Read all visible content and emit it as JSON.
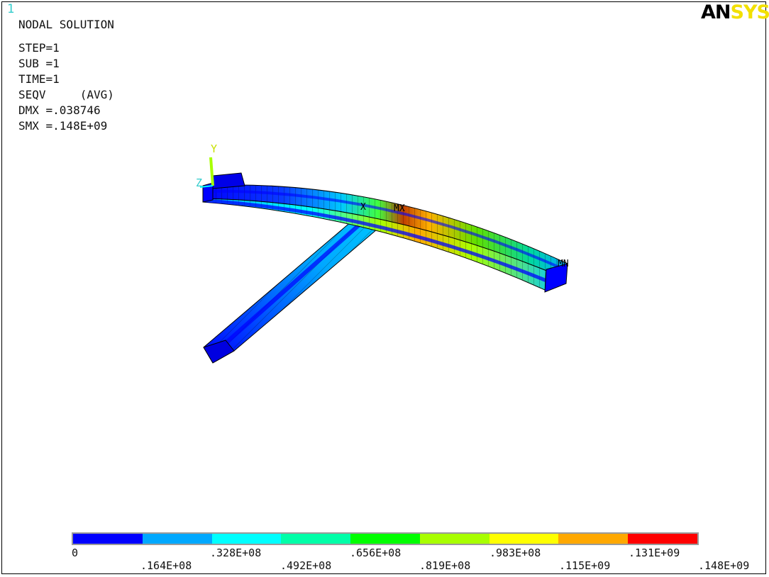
{
  "window_number": "1",
  "logo": {
    "an": "AN",
    "sys": "SYS"
  },
  "info": {
    "title": "NODAL SOLUTION",
    "step": "STEP=1",
    "sub": "SUB =1",
    "time": "TIME=1",
    "seqv": "SEQV     (AVG)",
    "dmx": "DMX =.038746",
    "smx": "SMX =.148E+09"
  },
  "axis_labels": {
    "y": "Y",
    "z": "Z",
    "x": "X",
    "mx": "MX",
    "mn": "MN"
  },
  "legend": {
    "colors": [
      "#0000ff",
      "#00a8ff",
      "#00ffff",
      "#00ffa8",
      "#00ff00",
      "#a8ff00",
      "#ffff00",
      "#ffa800",
      "#ff0000"
    ],
    "upper_labels": [
      "0",
      ".328E+08",
      ".656E+08",
      ".983E+08",
      ".131E+09"
    ],
    "lower_labels": [
      ".164E+08",
      ".492E+08",
      ".819E+08",
      ".115E+09",
      ".148E+09"
    ]
  }
}
